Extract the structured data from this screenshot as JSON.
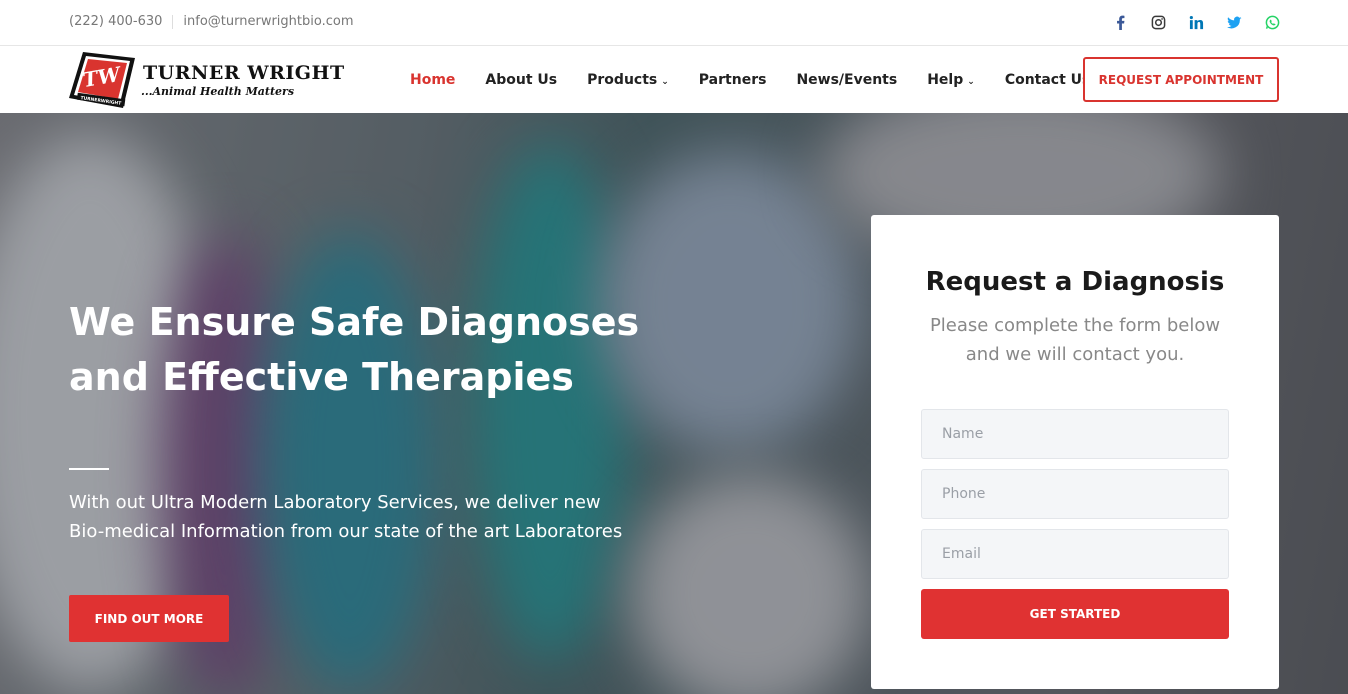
{
  "topbar": {
    "phone": "(222) 400-630",
    "email": "info@turnerwrightbio.com",
    "social": [
      "facebook-icon",
      "instagram-icon",
      "linkedin-icon",
      "twitter-icon",
      "whatsapp-icon"
    ]
  },
  "logo": {
    "brand": "TURNER WRIGHT",
    "tagline": "...Animal Health Matters",
    "badge_text": "TW",
    "badge_subtext": "TURNERWRIGHT"
  },
  "nav": {
    "items": [
      {
        "label": "Home",
        "active": true
      },
      {
        "label": "About Us"
      },
      {
        "label": "Products",
        "dropdown": true
      },
      {
        "label": "Partners"
      },
      {
        "label": "News/Events"
      },
      {
        "label": "Help",
        "dropdown": true
      },
      {
        "label": "Contact Us"
      }
    ],
    "cta": "REQUEST APPOINTMENT"
  },
  "hero": {
    "title": "We Ensure Safe Diagnoses and Effective Therapies",
    "subtitle": "With out Ultra Modern Laboratory Services, we deliver new Bio-medical Information from our state of the art Laboratores",
    "button": "FIND OUT MORE"
  },
  "form": {
    "title": "Request a Diagnosis",
    "description": "Please complete the form below and we will contact you.",
    "name_placeholder": "Name",
    "phone_placeholder": "Phone",
    "email_placeholder": "Email",
    "submit": "GET STARTED"
  },
  "colors": {
    "accent": "#e03232",
    "facebook": "#3b5998",
    "instagram": "#333333",
    "linkedin": "#0077b5",
    "twitter": "#1da1f2",
    "whatsapp": "#25d366"
  }
}
